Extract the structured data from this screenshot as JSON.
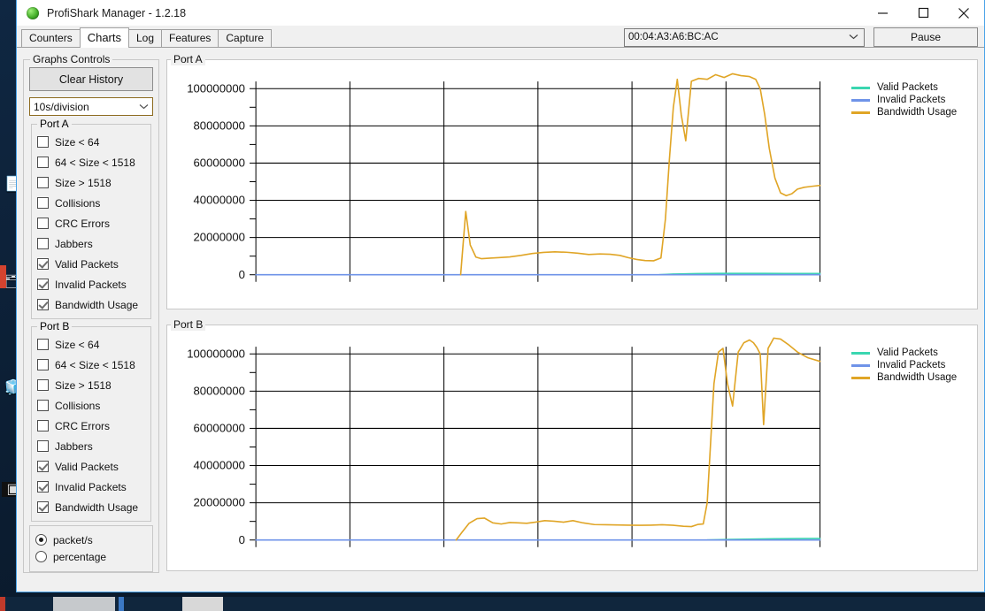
{
  "window": {
    "title": "ProfiShark Manager - 1.2.18",
    "logo_icon": "green-sphere-icon",
    "minimize_label": "minimize-icon",
    "maximize_label": "maximize-icon",
    "close_label": "close-icon"
  },
  "tabs": [
    {
      "label": "Counters",
      "active": false
    },
    {
      "label": "Charts",
      "active": true
    },
    {
      "label": "Log",
      "active": false
    },
    {
      "label": "Features",
      "active": false
    },
    {
      "label": "Capture",
      "active": false
    }
  ],
  "toolbar": {
    "device_value": "00:04:A3:A6:BC:AC",
    "device_chevron": "▼",
    "pause_label": "Pause"
  },
  "sidebar": {
    "graphs_controls_title": "Graphs Controls",
    "clear_history_label": "Clear History",
    "division_value": "10s/division",
    "division_chevron": "▼",
    "port_a_title": "Port A",
    "port_b_title": "Port B",
    "port_a_options": [
      {
        "label": "Size < 64",
        "checked": false
      },
      {
        "label": "64 < Size < 1518",
        "checked": false
      },
      {
        "label": "Size > 1518",
        "checked": false
      },
      {
        "label": "Collisions",
        "checked": false
      },
      {
        "label": "CRC Errors",
        "checked": false
      },
      {
        "label": "Jabbers",
        "checked": false
      },
      {
        "label": "Valid Packets",
        "checked": true
      },
      {
        "label": "Invalid Packets",
        "checked": true
      },
      {
        "label": "Bandwidth Usage",
        "checked": true
      }
    ],
    "port_b_options": [
      {
        "label": "Size < 64",
        "checked": false
      },
      {
        "label": "64 < Size < 1518",
        "checked": false
      },
      {
        "label": "Size > 1518",
        "checked": false
      },
      {
        "label": "Collisions",
        "checked": false
      },
      {
        "label": "CRC Errors",
        "checked": false
      },
      {
        "label": "Jabbers",
        "checked": false
      },
      {
        "label": "Valid Packets",
        "checked": true
      },
      {
        "label": "Invalid Packets",
        "checked": true
      },
      {
        "label": "Bandwidth Usage",
        "checked": true
      }
    ],
    "unit_options": [
      {
        "label": "packet/s",
        "selected": true
      },
      {
        "label": "percentage",
        "selected": false
      }
    ]
  },
  "colors": {
    "valid_packets": "#3ad6b0",
    "invalid_packets": "#6f93e8",
    "bandwidth_usage": "#e0a526",
    "grid": "#000000",
    "window_bg": "#f0f0f0",
    "accent_border": "#4aa3e8"
  },
  "chart_data": [
    {
      "type": "line",
      "title": "Port A",
      "xlabel": "",
      "ylabel": "",
      "ylim": [
        0,
        110000000
      ],
      "yticks": [
        0,
        20000000,
        40000000,
        60000000,
        80000000,
        100000000
      ],
      "ytick_labels": [
        "0",
        "20000000",
        "40000000",
        "60000000",
        "80000000",
        "100000000"
      ],
      "minor_ytick_step": 10000000,
      "x_divisions": 6,
      "x_division_seconds": 10,
      "grid": true,
      "legend_position": "right",
      "series": [
        {
          "name": "Valid Packets",
          "color": "#3ad6b0",
          "x": [
            0.715,
            0.74,
            0.78,
            0.82,
            0.86,
            0.9,
            0.94,
            0.97,
            1.0
          ],
          "values": [
            0,
            350000,
            600000,
            700000,
            720000,
            700000,
            680000,
            660000,
            640000
          ]
        },
        {
          "name": "Invalid Packets",
          "color": "#6f93e8",
          "x": [
            0.0,
            1.0
          ],
          "values": [
            0,
            0
          ]
        },
        {
          "name": "Bandwidth Usage",
          "color": "#e0a526",
          "x": [
            0.363,
            0.372,
            0.38,
            0.39,
            0.4,
            0.415,
            0.432,
            0.45,
            0.47,
            0.49,
            0.51,
            0.53,
            0.55,
            0.57,
            0.59,
            0.61,
            0.628,
            0.645,
            0.66,
            0.675,
            0.69,
            0.705,
            0.718,
            0.726,
            0.733,
            0.74,
            0.747,
            0.754,
            0.762,
            0.772,
            0.785,
            0.8,
            0.815,
            0.83,
            0.845,
            0.86,
            0.875,
            0.886,
            0.894,
            0.902,
            0.91,
            0.92,
            0.93,
            0.94,
            0.95,
            0.96,
            0.972,
            0.985,
            1.0
          ],
          "values": [
            0,
            34000000,
            16000000,
            9500000,
            8600000,
            8900000,
            9200000,
            9600000,
            10400000,
            11400000,
            12000000,
            12300000,
            12100000,
            11600000,
            10900000,
            11200000,
            11000000,
            10400000,
            9200000,
            8200000,
            7600000,
            7500000,
            9000000,
            30000000,
            62000000,
            90000000,
            105000000,
            86000000,
            72000000,
            104000000,
            105500000,
            105000000,
            107500000,
            106000000,
            108000000,
            107000000,
            106500000,
            105000000,
            100000000,
            86000000,
            68000000,
            52000000,
            44000000,
            42500000,
            43500000,
            46000000,
            47000000,
            47500000,
            48000000
          ]
        }
      ]
    },
    {
      "type": "line",
      "title": "Port B",
      "xlabel": "",
      "ylabel": "",
      "ylim": [
        0,
        110000000
      ],
      "yticks": [
        0,
        20000000,
        40000000,
        60000000,
        80000000,
        100000000
      ],
      "ytick_labels": [
        "0",
        "20000000",
        "40000000",
        "60000000",
        "80000000",
        "100000000"
      ],
      "minor_ytick_step": 10000000,
      "x_divisions": 6,
      "x_division_seconds": 10,
      "grid": true,
      "legend_position": "right",
      "series": [
        {
          "name": "Valid Packets",
          "color": "#3ad6b0",
          "x": [
            0.8,
            0.84,
            0.88,
            0.92,
            0.96,
            1.0
          ],
          "values": [
            0,
            300000,
            500000,
            650000,
            760000,
            820000
          ]
        },
        {
          "name": "Invalid Packets",
          "color": "#6f93e8",
          "x": [
            0.0,
            1.0
          ],
          "values": [
            0,
            0
          ]
        },
        {
          "name": "Bandwidth Usage",
          "color": "#e0a526",
          "x": [
            0.355,
            0.365,
            0.378,
            0.392,
            0.405,
            0.42,
            0.435,
            0.45,
            0.465,
            0.48,
            0.495,
            0.512,
            0.528,
            0.545,
            0.562,
            0.58,
            0.6,
            0.62,
            0.64,
            0.66,
            0.68,
            0.7,
            0.72,
            0.74,
            0.758,
            0.772,
            0.784,
            0.793,
            0.8,
            0.806,
            0.812,
            0.82,
            0.828,
            0.836,
            0.845,
            0.855,
            0.865,
            0.875,
            0.882,
            0.888,
            0.894,
            0.9,
            0.908,
            0.918,
            0.93,
            0.944,
            0.96,
            0.978,
            1.0
          ],
          "values": [
            0,
            4000000,
            9000000,
            11500000,
            11800000,
            9200000,
            8600000,
            9400000,
            9200000,
            9000000,
            9600000,
            10400000,
            10100000,
            9600000,
            10400000,
            9200000,
            8300000,
            8200000,
            8100000,
            8000000,
            7900000,
            8000000,
            8200000,
            7900000,
            7400000,
            7200000,
            8400000,
            8600000,
            20000000,
            52000000,
            84000000,
            101000000,
            103000000,
            84000000,
            72000000,
            101000000,
            106000000,
            107500000,
            106000000,
            103500000,
            100000000,
            62000000,
            103000000,
            108500000,
            108000000,
            105000000,
            101000000,
            98000000,
            96000000
          ]
        }
      ]
    }
  ]
}
